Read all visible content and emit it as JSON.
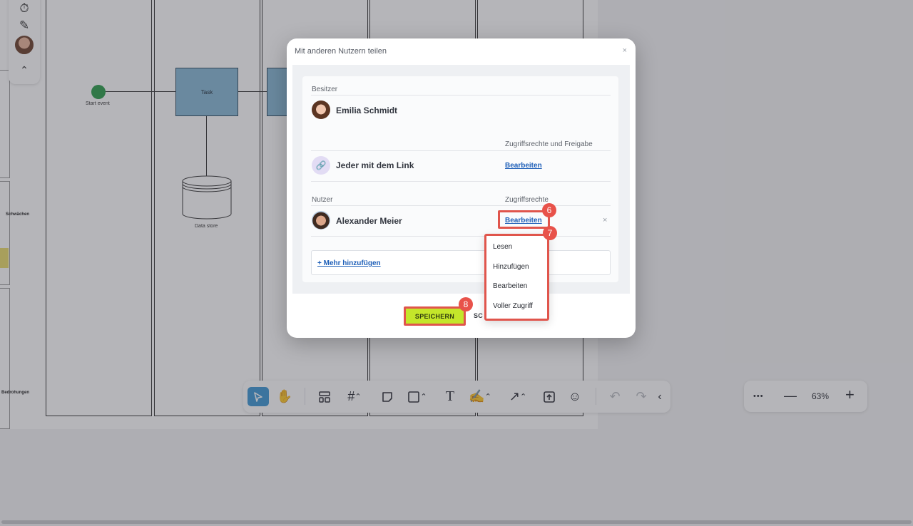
{
  "canvas": {
    "task_label": "Task",
    "start_event_label": "Start event",
    "data_store_label": "Data store",
    "weaknesses_label": "Schwächen",
    "threats_label": "Bedrohungen"
  },
  "left_toolbar": {
    "icons": [
      "timer-icon",
      "no-pen-icon",
      "avatar",
      "chevron-up-icon"
    ]
  },
  "modal": {
    "title": "Mit anderen Nutzern teilen",
    "close": "×",
    "owner_label": "Besitzer",
    "owner_name": "Emilia Schmidt",
    "access_header": "Zugriffsrechte und Freigabe",
    "link_label": "Jeder mit dem Link",
    "link_edit": "Bearbeiten",
    "users_label": "Nutzer",
    "rights_label": "Zugriffsrechte",
    "user_name": "Alexander Meier",
    "user_edit": "Bearbeiten",
    "remove": "×",
    "add_more": "+ Mehr hinzufügen",
    "save": "SPEICHERN",
    "close_btn": "SC"
  },
  "dropdown": {
    "options": [
      "Lesen",
      "Hinzufügen",
      "Bearbeiten",
      "Voller Zugriff"
    ]
  },
  "badges": {
    "b6": "6",
    "b7": "7",
    "b8": "8"
  },
  "zoom": {
    "more": "•••",
    "minus": "—",
    "value": "63%",
    "plus": "+"
  },
  "colors": {
    "accent_blue": "#3c97d4",
    "save_green": "#c4e62a",
    "highlight_red": "#e0554c",
    "link_blue": "#1e5fb8"
  }
}
